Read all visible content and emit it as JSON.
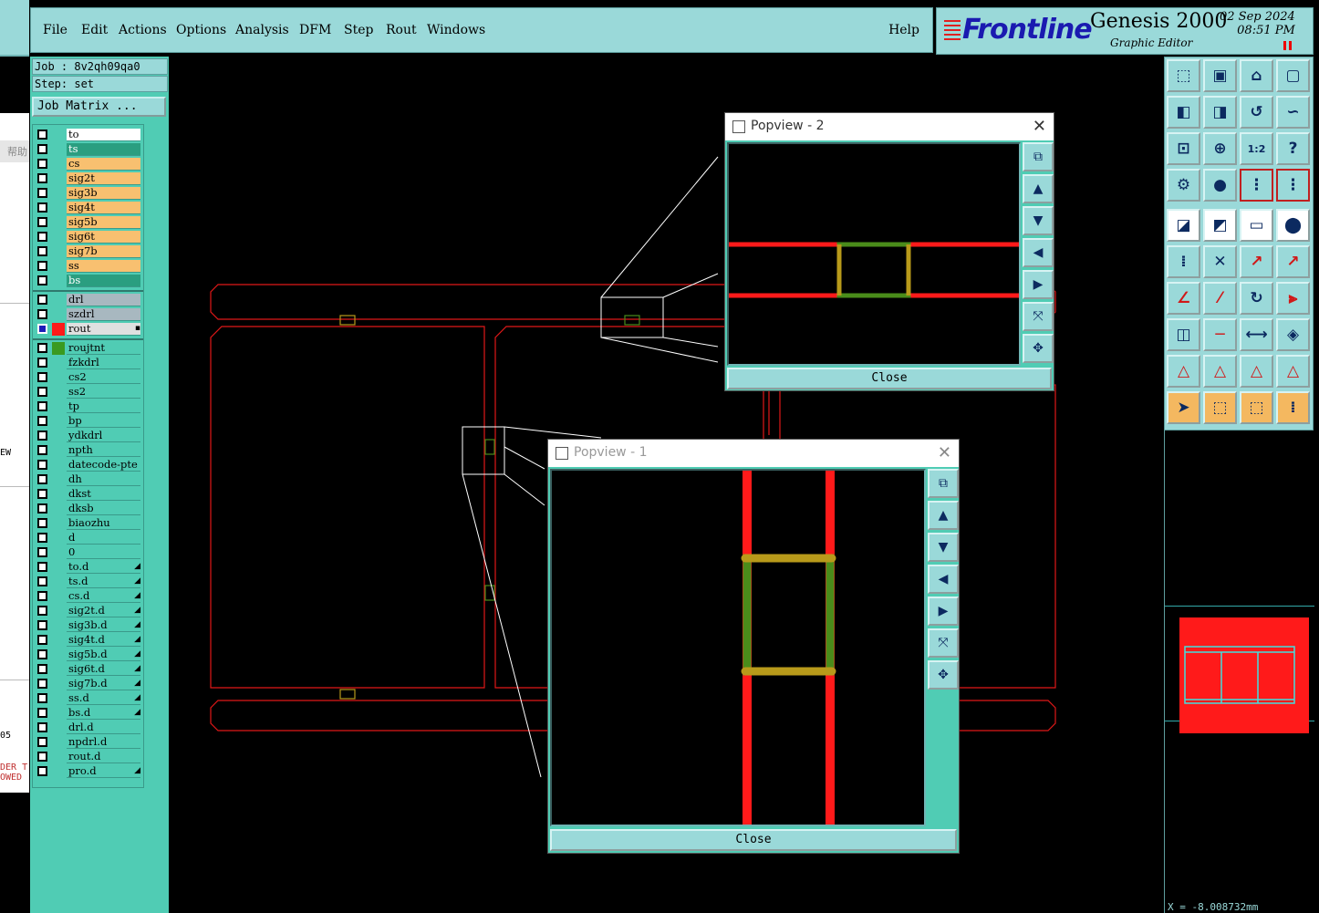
{
  "menubar": {
    "items": [
      {
        "label": "File"
      },
      {
        "label": "Edit"
      },
      {
        "label": "Actions"
      },
      {
        "label": "Options"
      },
      {
        "label": "Analysis"
      },
      {
        "label": "DFM"
      },
      {
        "label": "Step"
      },
      {
        "label": "Rout"
      },
      {
        "label": "Windows"
      }
    ],
    "help": "Help"
  },
  "logo": {
    "brand": "Frontline",
    "product": "Genesis 2000",
    "subtitle": "Graphic Editor",
    "date": "02 Sep 2024",
    "time": "08:51 PM"
  },
  "job": {
    "job_line": "Job : 8v2qh09qa0",
    "step_line": "Step: set",
    "matrix_button": "Job Matrix ..."
  },
  "layers": {
    "group1": [
      {
        "name": "to",
        "color": "#ffffff"
      },
      {
        "name": "ts",
        "color": "#2a9e80"
      },
      {
        "name": "cs",
        "color": "#f8c070"
      },
      {
        "name": "sig2t",
        "color": "#f8c070"
      },
      {
        "name": "sig3b",
        "color": "#f8c070"
      },
      {
        "name": "sig4t",
        "color": "#f8c070"
      },
      {
        "name": "sig5b",
        "color": "#f8c070"
      },
      {
        "name": "sig6t",
        "color": "#f8c070"
      },
      {
        "name": "sig7b",
        "color": "#f8c070"
      },
      {
        "name": "ss",
        "color": "#f8c070"
      },
      {
        "name": "bs",
        "color": "#2a9e80"
      }
    ],
    "group2": [
      {
        "name": "drl",
        "color": "#a8b8c0"
      },
      {
        "name": "szdrl",
        "color": "#a8b8c0"
      },
      {
        "name": "rout",
        "color": "#e0e0e0",
        "active": true,
        "chip": "#ff1a1a"
      }
    ],
    "group3": [
      {
        "name": "roujtnt",
        "chip": "#3a9a20"
      },
      {
        "name": "fzkdrl"
      },
      {
        "name": "cs2"
      },
      {
        "name": "ss2"
      },
      {
        "name": "tp"
      },
      {
        "name": "bp"
      },
      {
        "name": "ydkdrl"
      },
      {
        "name": "npth"
      },
      {
        "name": "datecode-pte"
      },
      {
        "name": "dh"
      },
      {
        "name": "dkst"
      },
      {
        "name": "dksb"
      },
      {
        "name": "biaozhu"
      },
      {
        "name": "d"
      },
      {
        "name": "0"
      },
      {
        "name": "to.d",
        "mark": true
      },
      {
        "name": "ts.d",
        "mark": true
      },
      {
        "name": "cs.d",
        "mark": true
      },
      {
        "name": "sig2t.d",
        "mark": true
      },
      {
        "name": "sig3b.d",
        "mark": true
      },
      {
        "name": "sig4t.d",
        "mark": true
      },
      {
        "name": "sig5b.d",
        "mark": true
      },
      {
        "name": "sig6t.d",
        "mark": true
      },
      {
        "name": "sig7b.d",
        "mark": true
      },
      {
        "name": "ss.d",
        "mark": true
      },
      {
        "name": "bs.d",
        "mark": true
      },
      {
        "name": "drl.d"
      },
      {
        "name": "npdrl.d"
      },
      {
        "name": "rout.d"
      },
      {
        "name": "pro.d",
        "mark": true
      }
    ]
  },
  "popview1": {
    "title": "Popview - 1",
    "close": "Close"
  },
  "popview2": {
    "title": "Popview - 2",
    "close": "Close"
  },
  "status": {
    "coord": "X = -8.008732mm"
  },
  "left_strip": {
    "chinese_label": "帮助",
    "frag1": "EW",
    "frag2": "05",
    "frag3": "DER T",
    "frag4": "OWED"
  },
  "colors": {
    "panel_bg": "#50ccb4",
    "menu_bg": "#9ad9d9",
    "rout_red": "#ff1a1a",
    "pad_green": "#4a8c1a",
    "pad_yellow": "#b89a1a"
  }
}
